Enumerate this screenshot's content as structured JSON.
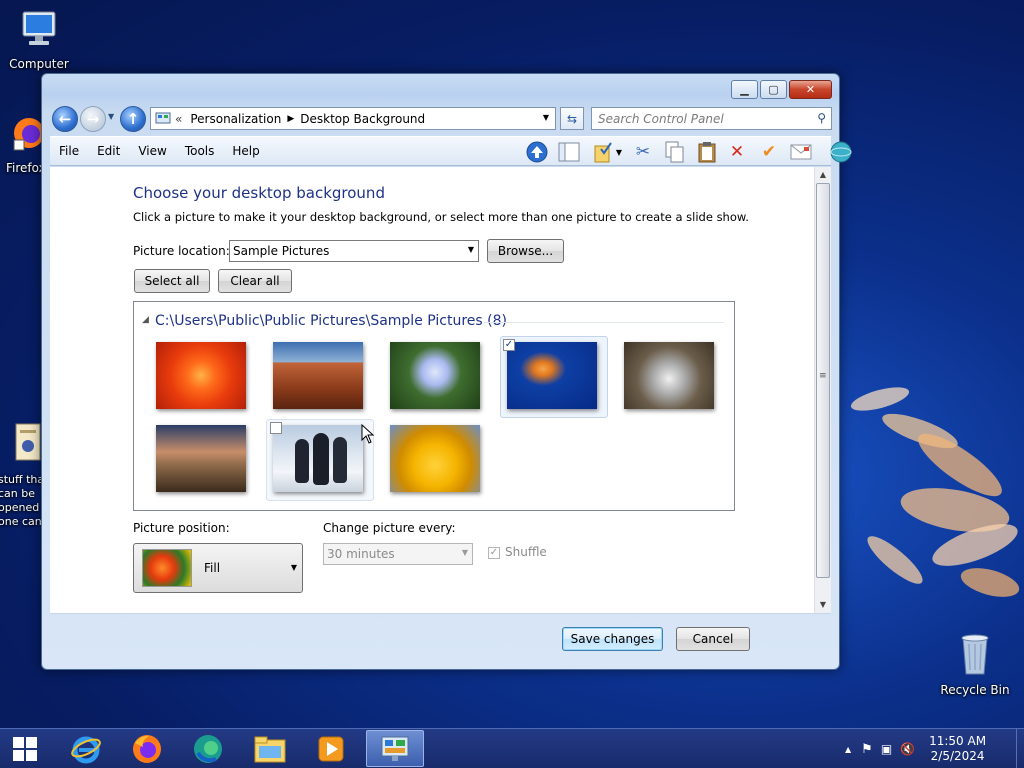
{
  "desktop": {
    "icons": [
      {
        "label": "Computer"
      },
      {
        "label": "Firefox"
      },
      {
        "label": "stuff that can be opened in one can"
      },
      {
        "label": "Recycle Bin"
      }
    ]
  },
  "window": {
    "breadcrumb": {
      "overflow": "«",
      "items": [
        "Personalization",
        "Desktop Background"
      ]
    },
    "search_placeholder": "Search Control Panel",
    "menu": [
      "File",
      "Edit",
      "View",
      "Tools",
      "Help"
    ],
    "content": {
      "title": "Choose your desktop background",
      "subtitle": "Click a picture to make it your desktop background, or select more than one picture to create a slide show.",
      "picture_location_label": "Picture location:",
      "picture_location_value": "Sample Pictures",
      "browse_label": "Browse...",
      "select_all_label": "Select all",
      "clear_all_label": "Clear all",
      "group_header": "C:\\Users\\Public\\Public Pictures\\Sample Pictures (8)",
      "pictures": [
        {
          "name": "Chrysanthemum",
          "checked": false
        },
        {
          "name": "Desert",
          "checked": false
        },
        {
          "name": "Hydrangeas",
          "checked": false
        },
        {
          "name": "Jellyfish",
          "checked": true
        },
        {
          "name": "Koala",
          "checked": false
        },
        {
          "name": "Lighthouse",
          "checked": false
        },
        {
          "name": "Penguins",
          "checked": false
        },
        {
          "name": "Tulips",
          "checked": false
        }
      ],
      "picture_position_label": "Picture position:",
      "picture_position_value": "Fill",
      "change_every_label": "Change picture every:",
      "change_every_value": "30 minutes",
      "shuffle_label": "Shuffle",
      "shuffle_checked": true
    },
    "footer": {
      "save_label": "Save changes",
      "cancel_label": "Cancel"
    }
  },
  "taskbar": {
    "apps": [
      "start-button",
      "internet-explorer",
      "firefox",
      "edge",
      "file-explorer",
      "media-player",
      "control-panel"
    ],
    "time": "11:50 AM",
    "date": "2/5/2024"
  },
  "colors": {
    "title_blue": "#1e3287",
    "desktop_blue": "#0b2f8a",
    "taskbar": "#1f347a"
  }
}
